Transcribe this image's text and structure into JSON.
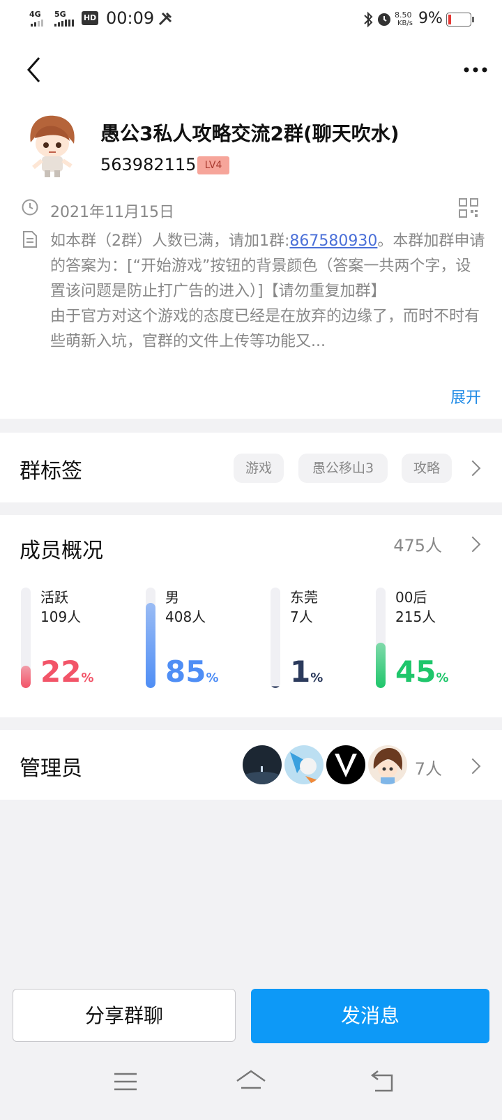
{
  "status_bar": {
    "network1": "4G",
    "network2": "5G",
    "hd": "HD",
    "time": "00:09",
    "speed_value": "8.50",
    "speed_unit": "KB/s",
    "battery": "9%"
  },
  "group": {
    "name": "愚公3私人攻略交流2群(聊天吹水)",
    "id": "563982115",
    "level": "LV4",
    "created_date": "2021年11月15日",
    "description_prefix": "如本群（2群）人数已满，请加1群:",
    "description_number": "867580930",
    "description_suffix": "。本群加群申请的答案为：[“开始游戏”按钮的背景颜色（答案一共两个字，设置该问题是防止打广告的进入）]【请勿重复加群】",
    "description_more": "由于官方对这个游戏的态度已经是在放弃的边缘了，而时不时有些萌新入坑，官群的文件上传等功能又...",
    "expand_label": "展开"
  },
  "tags_section": {
    "title": "群标签",
    "tags": [
      "游戏",
      "愚公移山3",
      "攻略"
    ]
  },
  "members_section": {
    "title": "成员概况",
    "total": "475人",
    "stats": [
      {
        "label": "活跃",
        "count": "109人",
        "percent": "22",
        "unit": "%",
        "fill": 0.22,
        "color": "#f25468"
      },
      {
        "label": "男",
        "count": "408人",
        "percent": "85",
        "unit": "%",
        "fill": 0.85,
        "color": "#4f8ef5"
      },
      {
        "label": "东莞",
        "count": "7人",
        "percent": "1",
        "unit": "%",
        "fill": 0.01,
        "color": "#2b3a5c"
      },
      {
        "label": "00后",
        "count": "215人",
        "percent": "45",
        "unit": "%",
        "fill": 0.45,
        "color": "#1fc66b"
      }
    ]
  },
  "admins_section": {
    "title": "管理员",
    "count": "7人"
  },
  "actions": {
    "share_label": "分享群聊",
    "send_label": "发消息"
  }
}
